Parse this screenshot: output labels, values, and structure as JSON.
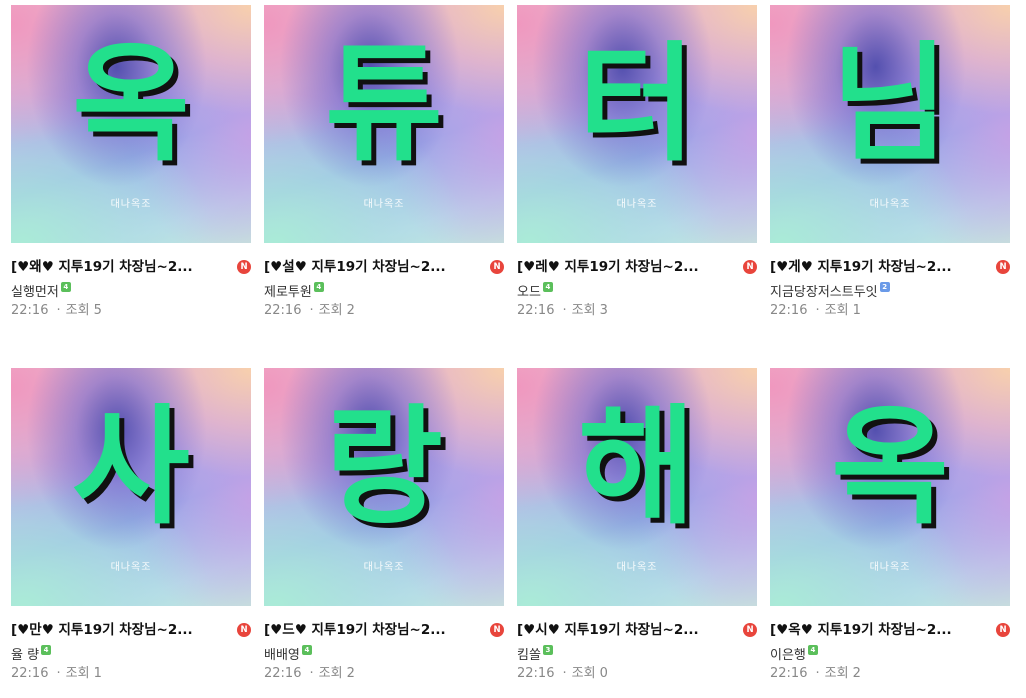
{
  "posts": [
    {
      "glyph": "옥",
      "caption": "대나옥조",
      "title": "[♥왜♥ 지투19기 차장님~2...",
      "new": "N",
      "author": "실행먼저",
      "level_color": "#5bbf5b",
      "level": "4",
      "time": "22:16",
      "dot": "·",
      "views_label": "조회",
      "views": "5"
    },
    {
      "glyph": "튜",
      "caption": "대나옥조",
      "title": "[♥설♥ 지투19기 차장님~2...",
      "new": "N",
      "author": "제로투원",
      "level_color": "#5bbf5b",
      "level": "4",
      "time": "22:16",
      "dot": "·",
      "views_label": "조회",
      "views": "2"
    },
    {
      "glyph": "터",
      "caption": "대나옥조",
      "title": "[♥레♥ 지투19기 차장님~2...",
      "new": "N",
      "author": "오드",
      "level_color": "#5bbf5b",
      "level": "4",
      "time": "22:16",
      "dot": "·",
      "views_label": "조회",
      "views": "3"
    },
    {
      "glyph": "님",
      "caption": "대나옥조",
      "title": "[♥게♥ 지투19기 차장님~2...",
      "new": "N",
      "author": "지금당장저스트두잇",
      "level_color": "#6a9ae8",
      "level": "2",
      "time": "22:16",
      "dot": "·",
      "views_label": "조회",
      "views": "1"
    },
    {
      "glyph": "사",
      "caption": "대나옥조",
      "title": "[♥만♥ 지투19기 차장님~2...",
      "new": "N",
      "author": "율 량",
      "level_color": "#5bbf5b",
      "level": "4",
      "time": "22:16",
      "dot": "·",
      "views_label": "조회",
      "views": "1"
    },
    {
      "glyph": "랑",
      "caption": "대나옥조",
      "title": "[♥드♥ 지투19기 차장님~2...",
      "new": "N",
      "author": "배배영",
      "level_color": "#5bbf5b",
      "level": "4",
      "time": "22:16",
      "dot": "·",
      "views_label": "조회",
      "views": "2"
    },
    {
      "glyph": "해",
      "caption": "대나옥조",
      "title": "[♥시♥ 지투19기 차장님~2...",
      "new": "N",
      "author": "킴쏠",
      "level_color": "#5bbf5b",
      "level": "3",
      "time": "22:16",
      "dot": "·",
      "views_label": "조회",
      "views": "0"
    },
    {
      "glyph": "옥",
      "caption": "대나옥조",
      "title": "[♥옥♥ 지투19기 차장님~2...",
      "new": "N",
      "author": "이은행",
      "level_color": "#5bbf5b",
      "level": "4",
      "time": "22:16",
      "dot": "·",
      "views_label": "조회",
      "views": "2"
    }
  ]
}
